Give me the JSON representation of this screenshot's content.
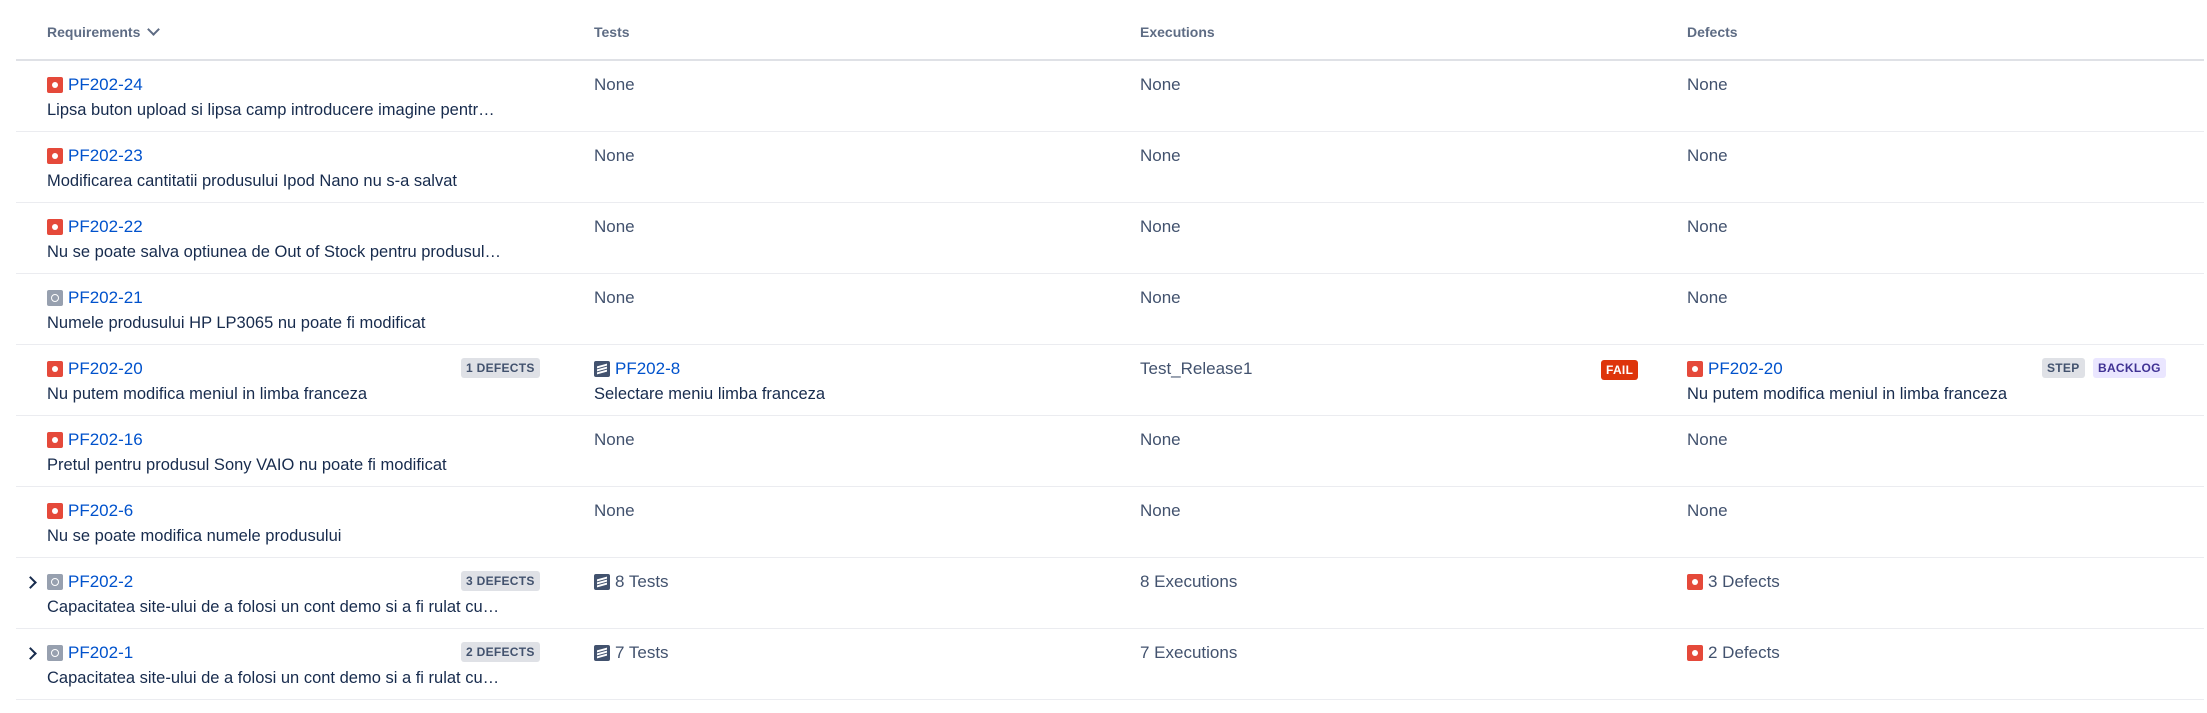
{
  "columns": {
    "requirements": "Requirements",
    "tests": "Tests",
    "executions": "Executions",
    "defects": "Defects"
  },
  "rows": [
    {
      "key": "PF202-24",
      "summary": "Lipsa buton upload si lipsa camp introducere imagine pentr…",
      "tests": "None",
      "executions": "None",
      "defects": "None"
    },
    {
      "key": "PF202-23",
      "summary": "Modificarea cantitatii produsului Ipod Nano nu s-a salvat",
      "tests": "None",
      "executions": "None",
      "defects": "None"
    },
    {
      "key": "PF202-22",
      "summary": "Nu se poate salva optiunea de Out of Stock pentru produsul…",
      "tests": "None",
      "executions": "None",
      "defects": "None"
    },
    {
      "key": "PF202-21",
      "summary": "Numele produsului HP LP3065 nu poate fi modificat",
      "tests": "None",
      "executions": "None",
      "defects": "None"
    },
    {
      "key": "PF202-20",
      "summary": "Nu putem modifica meniul in limba franceza",
      "badge": "1 DEFECTS",
      "test_key": "PF202-8",
      "test_summary": "Selectare meniu limba franceza",
      "execution": "Test_Release1",
      "exec_status": "FAIL",
      "defect_key": "PF202-20",
      "defect_summary": "Nu putem modifica meniul in limba franceza",
      "defect_tags": [
        "STEP",
        "BACKLOG"
      ]
    },
    {
      "key": "PF202-16",
      "summary": "Pretul pentru produsul Sony VAIO nu poate fi modificat",
      "tests": "None",
      "executions": "None",
      "defects": "None"
    },
    {
      "key": "PF202-6",
      "summary": "Nu se poate modifica numele produsului",
      "tests": "None",
      "executions": "None",
      "defects": "None"
    },
    {
      "key": "PF202-2",
      "summary": "Capacitatea site-ului de a folosi un cont demo si a fi rulat cu…",
      "badge": "3 DEFECTS",
      "tests": "8 Tests",
      "executions": "8 Executions",
      "defects": "3 Defects"
    },
    {
      "key": "PF202-1",
      "summary": "Capacitatea site-ului de a folosi un cont demo si a fi rulat cu…",
      "badge": "2 DEFECTS",
      "tests": "7 Tests",
      "executions": "7 Executions",
      "defects": "2 Defects"
    }
  ],
  "colors": {
    "link": "#0052cc",
    "bug": "#e5493a",
    "fail": "#de350b",
    "header_text": "#5e6c84"
  }
}
